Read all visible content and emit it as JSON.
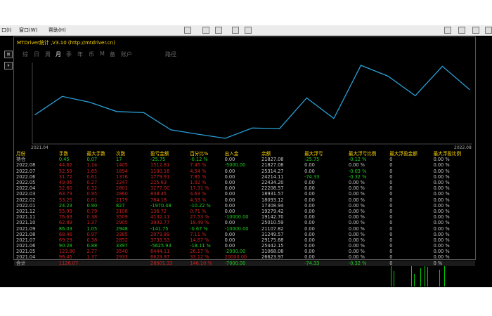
{
  "menubar": {
    "items": [
      {
        "label": "口(I)"
      },
      {
        "label": "窗口(W)"
      },
      {
        "label": "帮助(H)"
      }
    ]
  },
  "panel": {
    "title": "MTDriver统计 ,V3.10 (http://mtdriver.cn)",
    "tabs": [
      "综",
      "日",
      "周",
      "月",
      "季",
      "年",
      "币",
      "M",
      "备",
      "账户",
      "路径"
    ],
    "active_tab": "月"
  },
  "chart_data": {
    "type": "line",
    "x_start_label": "2021.04",
    "x_end_label": "2022.08",
    "line_color": "#2a9fd6",
    "x": [
      "2021.04",
      "2021.05",
      "2021.06",
      "2021.07",
      "2021.08",
      "2021.09",
      "2021.10",
      "2021.11",
      "2021.12",
      "2022.01",
      "2022.02",
      "2022.03",
      "2022.04",
      "2022.05",
      "2022.06",
      "2022.07",
      "2022.08"
    ],
    "values": [
      26623.97,
      31068.08,
      25442.15,
      29175.68,
      31249.57,
      21107.82,
      25010.59,
      19142.7,
      19279.42,
      17308.94,
      18093.12,
      18931.57,
      22208.57,
      22434.2,
      24214.11,
      25314.27,
      21827.08
    ]
  },
  "table": {
    "headers": [
      "月份",
      "手数",
      "最大手数",
      "次数",
      "盈亏金额",
      "百分比%",
      "出入金",
      "余额",
      "最大浮亏",
      "最大浮亏比例",
      "最大浮盈金额",
      "最大浮盈比例"
    ],
    "rows": [
      [
        "持仓",
        "0.45",
        "0.07",
        "17",
        "-25.75",
        "-0.12 %",
        "0.00",
        "21827.08",
        "-25.75",
        "-0.12 %",
        "0",
        "0.00 %"
      ],
      [
        "2022.08",
        "44.62",
        "1.14",
        "1405",
        "1512.81",
        "7.45 %",
        "-5000.00",
        "21827.08",
        "0.00",
        "0.00 %",
        "0",
        "0.00 %"
      ],
      [
        "2022.07",
        "52.59",
        "1.65",
        "1894",
        "1100.16",
        "4.54 %",
        "0.00",
        "25314.27",
        "0.00",
        "-0.03 %",
        "0",
        "0.00 %"
      ],
      [
        "2022.06",
        "31.72",
        "0.61",
        "1376",
        "1779.91",
        "7.85 %",
        "0.00",
        "24214.11",
        "-74.33",
        "-0.32 %",
        "0",
        "0.00 %"
      ],
      [
        "2022.05",
        "49.06",
        "0.27",
        "2247",
        "225.63",
        "1.02 %",
        "0.00",
        "22434.20",
        "0.00",
        "0.00 %",
        "0",
        "0.00 %"
      ],
      [
        "2022.04",
        "52.60",
        "0.32",
        "2801",
        "3277.00",
        "17.31 %",
        "0.00",
        "22208.57",
        "0.00",
        "0.00 %",
        "0",
        "0.00 %"
      ],
      [
        "2022.03",
        "63.73",
        "0.95",
        "2860",
        "838.45",
        "4.63 %",
        "0.00",
        "18931.57",
        "0.00",
        "0.00 %",
        "0",
        "0.00 %"
      ],
      [
        "2022.02",
        "53.25",
        "0.61",
        "2179",
        "784.18",
        "4.53 %",
        "0.00",
        "18093.12",
        "0.00",
        "0.00 %",
        "0",
        "0.00 %"
      ],
      [
        "2022.01",
        "24.23",
        "0.90",
        "827",
        "-1970.48",
        "-10.22 %",
        "0.00",
        "17308.94",
        "0.00",
        "0.00 %",
        "0",
        "0.00 %"
      ],
      [
        "2021.12",
        "55.99",
        "0.79",
        "2108",
        "136.72",
        "0.71 %",
        "0.00",
        "19279.42",
        "0.00",
        "0.00 %",
        "0",
        "0.00 %"
      ],
      [
        "2021.11",
        "76.63",
        "0.38",
        "3509",
        "4132.11",
        "27.53 %",
        "-10000.00",
        "19142.70",
        "0.00",
        "0.00 %",
        "0",
        "0.00 %"
      ],
      [
        "2021.10",
        "62.89",
        "1.37",
        "2905",
        "3902.77",
        "18.49 %",
        "0.00",
        "25010.59",
        "0.00",
        "0.00 %",
        "0",
        "0.00 %"
      ],
      [
        "2021.09",
        "86.03",
        "1.05",
        "2948",
        "-141.75",
        "-0.67 %",
        "-10000.00",
        "21107.82",
        "0.00",
        "0.00 %",
        "0",
        "0.00 %"
      ],
      [
        "2021.08",
        "68.46",
        "0.97",
        "3385",
        "2073.89",
        "7.11 %",
        "0.00",
        "31249.57",
        "0.00",
        "0.00 %",
        "0",
        "0.00 %"
      ],
      [
        "2021.07",
        "69.29",
        "0.38",
        "2852",
        "3733.53",
        "14.67 %",
        "0.00",
        "29175.68",
        "0.00",
        "0.00 %",
        "0",
        "0.00 %"
      ],
      [
        "2021.06",
        "90.28",
        "0.88",
        "3397",
        "-5625.93",
        "-18.11 %",
        "0.00",
        "25442.15",
        "0.00",
        "0.00 %",
        "0",
        "0.00 %"
      ],
      [
        "2021.05",
        "123.80",
        "2.77",
        "3540",
        "6444.11",
        "26.17 %",
        "-2000.00",
        "31068.08",
        "0.00",
        "0.00 %",
        "0",
        "0.00 %"
      ],
      [
        "2021.04",
        "96.45",
        "1.37",
        "2933",
        "6623.97",
        "33.12 %",
        "20000.00",
        "26623.97",
        "0.00",
        "0.00 %",
        "0",
        "0.00 %"
      ]
    ],
    "total": [
      "合计",
      "1126.07",
      "",
      "",
      "28001.33",
      "146.10 %",
      "-7000.00",
      "",
      "-74.33",
      "-0.32 %",
      "0",
      "0 %"
    ]
  },
  "colors": {
    "positive": "#cc2222",
    "negative": "#22cc22",
    "header": "#ffd700",
    "neutral": "#c8c8c8"
  }
}
